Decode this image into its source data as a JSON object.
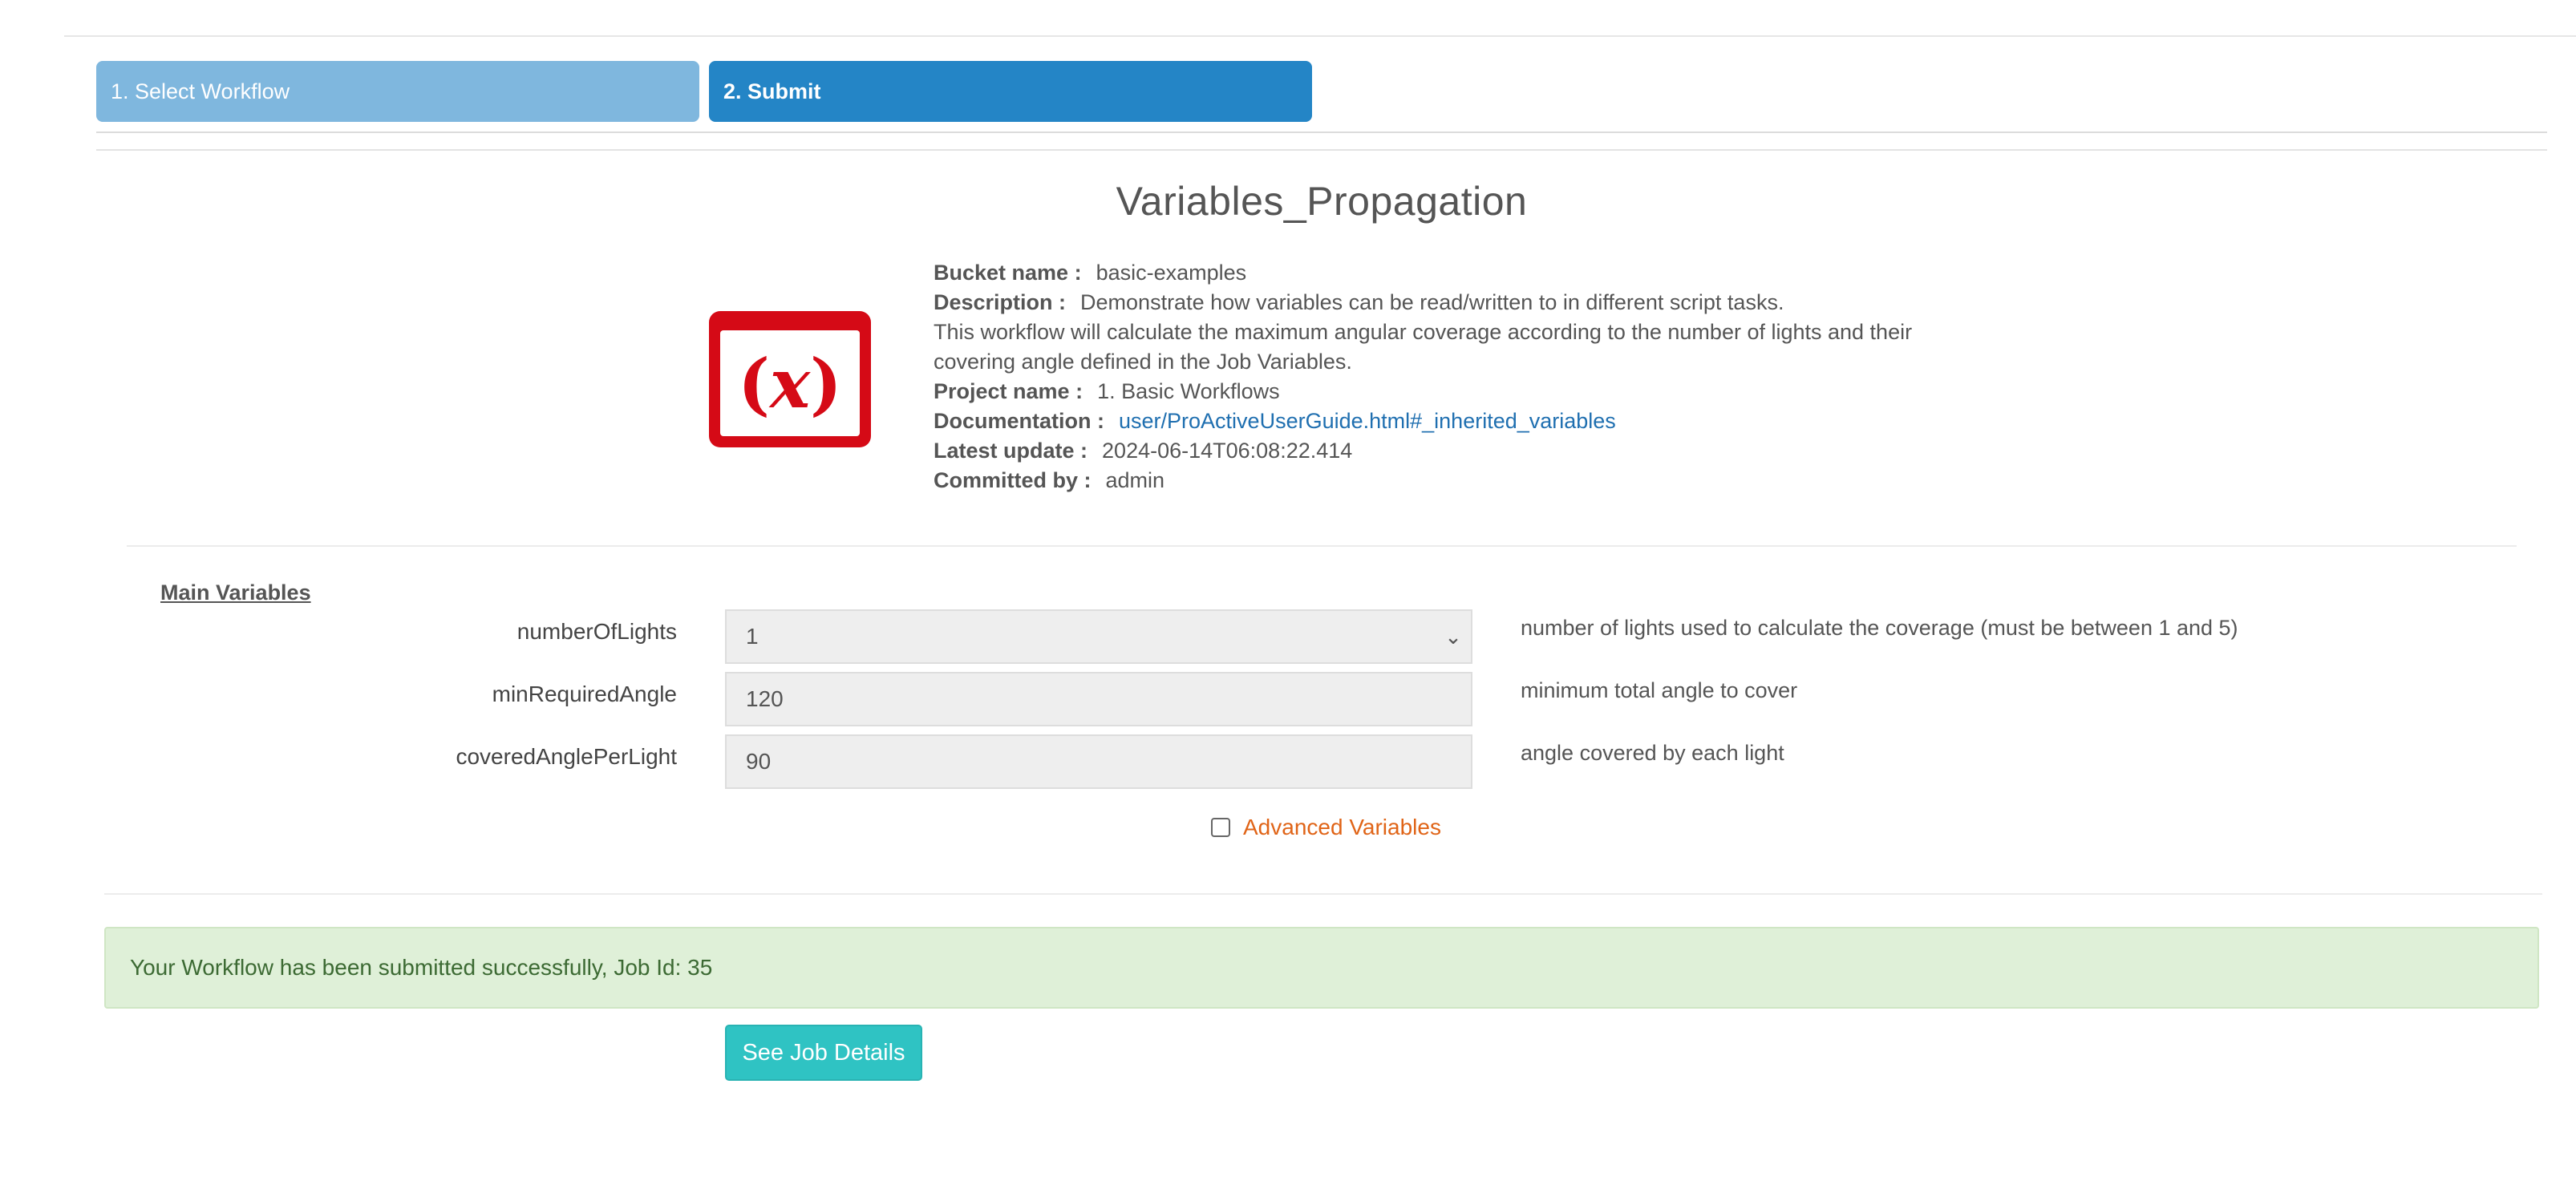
{
  "steps": {
    "step1_label": "1. Select Workflow",
    "step2_label": "2. Submit"
  },
  "workflow": {
    "title": "Variables_Propagation",
    "icon": "variable-x-icon",
    "meta": {
      "bucket_label": "Bucket name :",
      "bucket_value": "basic-examples",
      "description_label": "Description :",
      "description_line1": "Demonstrate how variables can be read/written to in different script tasks.",
      "description_line2": "This workflow will calculate the maximum angular coverage according to the number of lights and their",
      "description_line3": "covering angle defined in the Job Variables.",
      "project_label": "Project name :",
      "project_value": "1. Basic Workflows",
      "documentation_label": "Documentation :",
      "documentation_value": "user/ProActiveUserGuide.html#_inherited_variables",
      "update_label": "Latest update :",
      "update_value": "2024-06-14T06:08:22.414",
      "committed_label": "Committed by :",
      "committed_value": "admin"
    }
  },
  "variables": {
    "section_title": "Main Variables",
    "items": [
      {
        "name": "numberOfLights",
        "value": "1",
        "description": "number of lights used to calculate the coverage (must be between 1 and 5)"
      },
      {
        "name": "minRequiredAngle",
        "value": "120",
        "description": "minimum total angle to cover"
      },
      {
        "name": "coveredAnglePerLight",
        "value": "90",
        "description": "angle covered by each light"
      }
    ],
    "advanced_label": "Advanced Variables"
  },
  "alert": {
    "message": "Your Workflow has been submitted successfully, Job Id: 35"
  },
  "actions": {
    "see_job_details": "See Job Details"
  },
  "colors": {
    "step_inactive": "#7fb7de",
    "step_active": "#2485c6",
    "icon_red": "#d50a16",
    "link_blue": "#1f6fb0",
    "advanced_orange": "#e06417",
    "alert_bg": "#dff0d8",
    "button_teal": "#2fc3c3"
  }
}
